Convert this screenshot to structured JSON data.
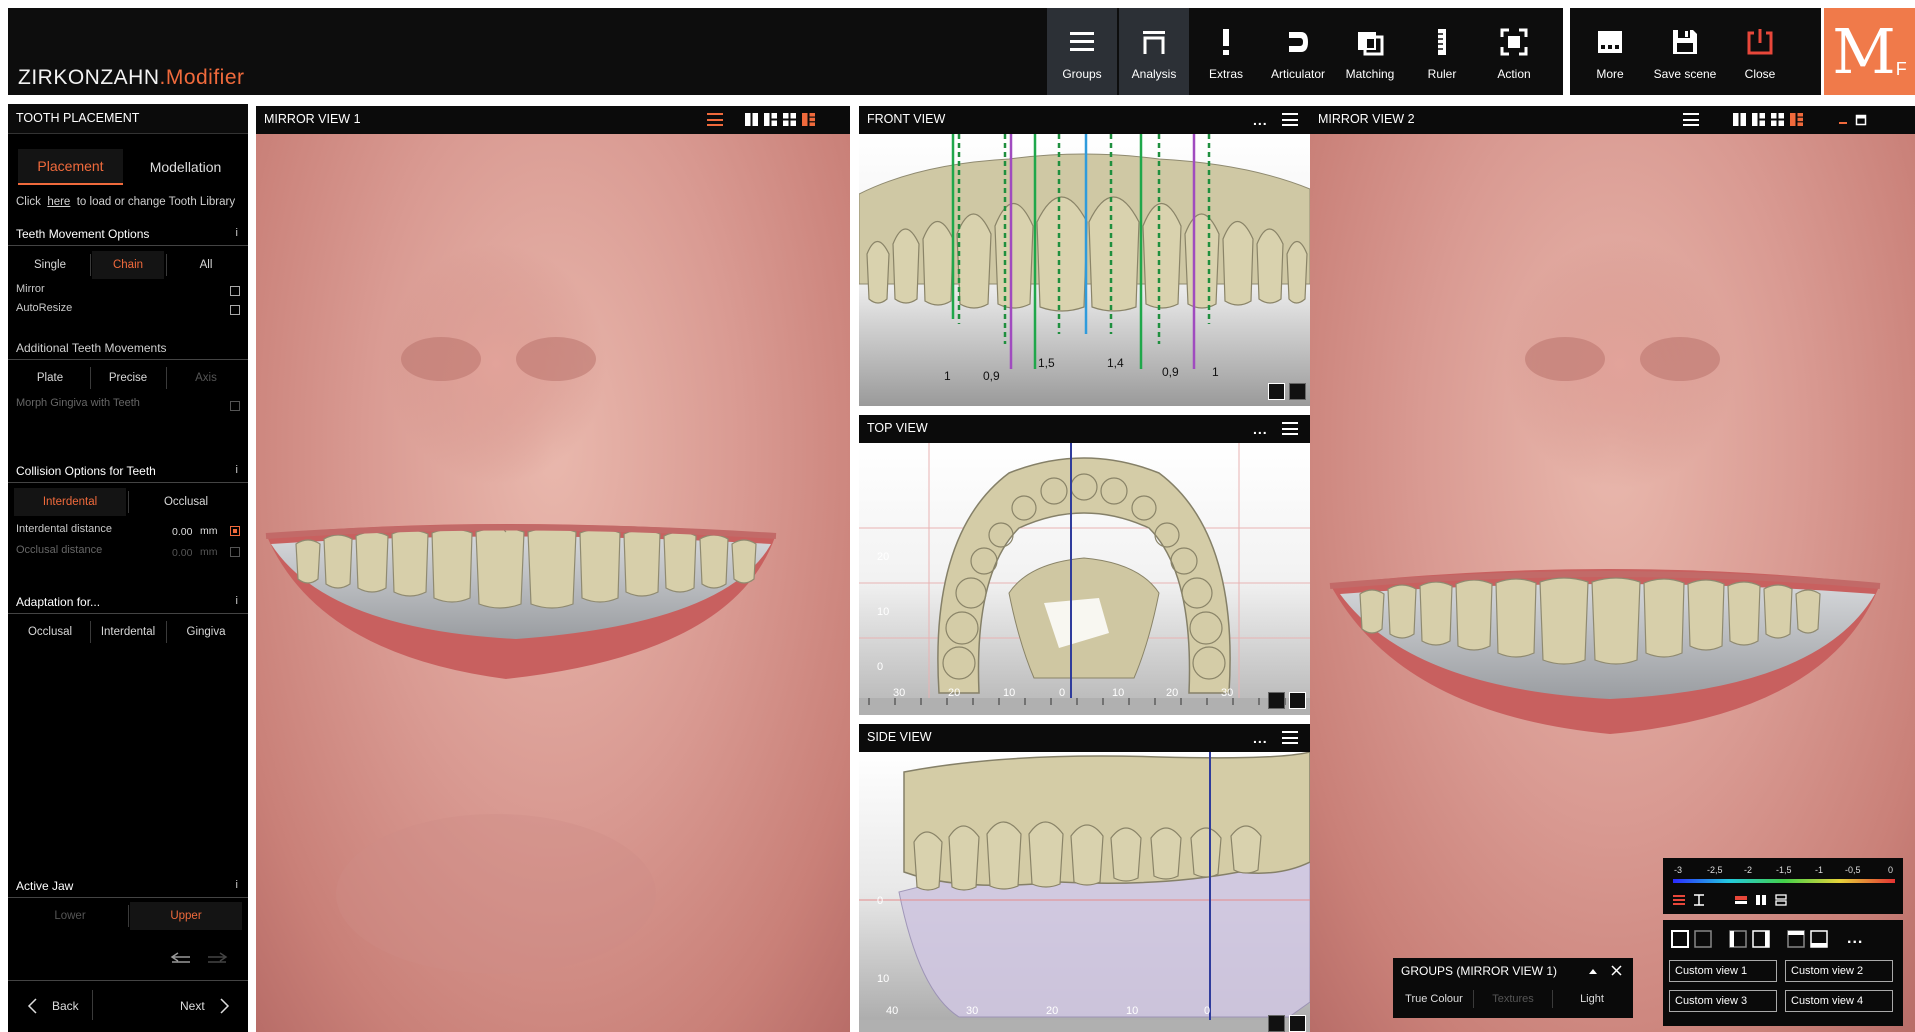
{
  "app": {
    "brand": "ZIRKONZAHN",
    "brand_suffix": ".Modifier",
    "logo_main": "M",
    "logo_sub": "F"
  },
  "toolbar": {
    "items": [
      {
        "label": "Groups",
        "icon": "groups-icon",
        "active": true
      },
      {
        "label": "Analysis",
        "icon": "analysis-icon",
        "active": true
      },
      {
        "label": "Extras",
        "icon": "extras-icon",
        "active": false
      },
      {
        "label": "Articulator",
        "icon": "articulator-icon",
        "active": false
      },
      {
        "label": "Matching",
        "icon": "matching-icon",
        "active": false
      },
      {
        "label": "Ruler",
        "icon": "ruler-icon",
        "active": false
      },
      {
        "label": "Action",
        "icon": "action-icon",
        "active": false
      }
    ],
    "right_items": [
      {
        "label": "More",
        "icon": "more-icon"
      },
      {
        "label": "Save scene",
        "icon": "save-icon"
      },
      {
        "label": "Close",
        "icon": "power-icon",
        "color": "#e8473a"
      }
    ]
  },
  "left_panel": {
    "title": "TOOTH PLACEMENT",
    "tabs": [
      "Placement",
      "Modellation"
    ],
    "hint_pre": "Click",
    "hint_link": "here",
    "hint_post": "to load or change Tooth Library",
    "teeth_movement": {
      "title": "Teeth Movement Options",
      "modes": [
        "Single",
        "Chain",
        "All"
      ],
      "selected": "Chain",
      "options": [
        {
          "label": "Mirror",
          "checked": false
        },
        {
          "label": "AutoResize",
          "checked": false
        }
      ]
    },
    "additional": {
      "title": "Additional Teeth Movements",
      "modes": [
        "Plate",
        "Precise",
        "Axis"
      ],
      "morph_label": "Morph Gingiva with Teeth"
    },
    "collision": {
      "title": "Collision Options for Teeth",
      "modes": [
        "Interdental",
        "Occlusal"
      ],
      "selected": "Interdental",
      "interdental_label": "Interdental distance",
      "interdental_value": "0.00",
      "occlusal_label": "Occlusal distance",
      "occlusal_value": "0.00",
      "unit": "mm"
    },
    "adaptation": {
      "title": "Adaptation for...",
      "modes": [
        "Occlusal",
        "Interdental",
        "Gingiva"
      ]
    },
    "active_jaw": {
      "title": "Active Jaw",
      "modes": [
        "Lower",
        "Upper"
      ],
      "selected": "Upper"
    },
    "info_glyph": "i",
    "nav": {
      "back": "Back",
      "next": "Next"
    }
  },
  "views": {
    "mirror1": {
      "title": "MIRROR VIEW 1"
    },
    "front": {
      "title": "FRONT VIEW",
      "measure_labels": [
        "1",
        "0,9",
        "1,5",
        "1,4",
        "0,9",
        "1"
      ],
      "more": "..."
    },
    "top": {
      "title": "TOP VIEW",
      "y_ticks": [
        "20",
        "10",
        "0"
      ],
      "x_ticks": [
        "30",
        "20",
        "10",
        "0",
        "10",
        "20",
        "30"
      ],
      "more": "..."
    },
    "side": {
      "title": "SIDE VIEW",
      "y_ticks": [
        "0",
        "10"
      ],
      "x_ticks": [
        "40",
        "30",
        "20",
        "10",
        "0"
      ],
      "more": "..."
    },
    "mirror2": {
      "title": "MIRROR VIEW 2"
    }
  },
  "colorscale": {
    "ticks": [
      "-3",
      "-2,5",
      "-2",
      "-1,5",
      "-1",
      "-0,5",
      "0"
    ]
  },
  "groups_panel": {
    "title": "GROUPS (MIRROR VIEW 1)",
    "tabs": [
      "True Colour",
      "Textures",
      "Light"
    ],
    "dim_tab": "Textures"
  },
  "custom_views": {
    "more": "...",
    "items": [
      "Custom view 1",
      "Custom view 2",
      "Custom view 3",
      "Custom view 4"
    ]
  },
  "colors": {
    "accent": "#f06a3c",
    "bar": "#0d0d0d",
    "active_tool": "#2c3036",
    "tooth": "#d7cfaa"
  }
}
